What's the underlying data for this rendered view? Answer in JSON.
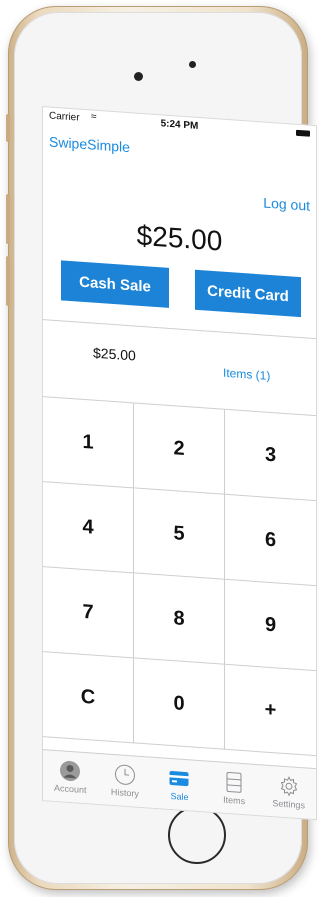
{
  "colors": {
    "accent": "#1a8be0",
    "button": "#1c83d6",
    "inactive": "#8e8e93"
  },
  "status": {
    "carrier": "Carrier",
    "time": "5:24 PM"
  },
  "header": {
    "title": "SwipeSimple",
    "logout": "Log out"
  },
  "sale": {
    "total": "$25.00",
    "cash_label": "Cash Sale",
    "credit_label": "Credit Card"
  },
  "summary": {
    "amount": "$25.00",
    "items_label": "Items (1)"
  },
  "keypad": {
    "keys": [
      "1",
      "2",
      "3",
      "4",
      "5",
      "6",
      "7",
      "8",
      "9",
      "C",
      "0",
      "+"
    ]
  },
  "tabbar": {
    "tabs": [
      {
        "label": "Account",
        "icon": "account-icon"
      },
      {
        "label": "History",
        "icon": "clock-icon"
      },
      {
        "label": "Sale",
        "icon": "card-icon",
        "active": true
      },
      {
        "label": "Items",
        "icon": "items-icon"
      },
      {
        "label": "Settings",
        "icon": "gear-icon"
      }
    ]
  }
}
